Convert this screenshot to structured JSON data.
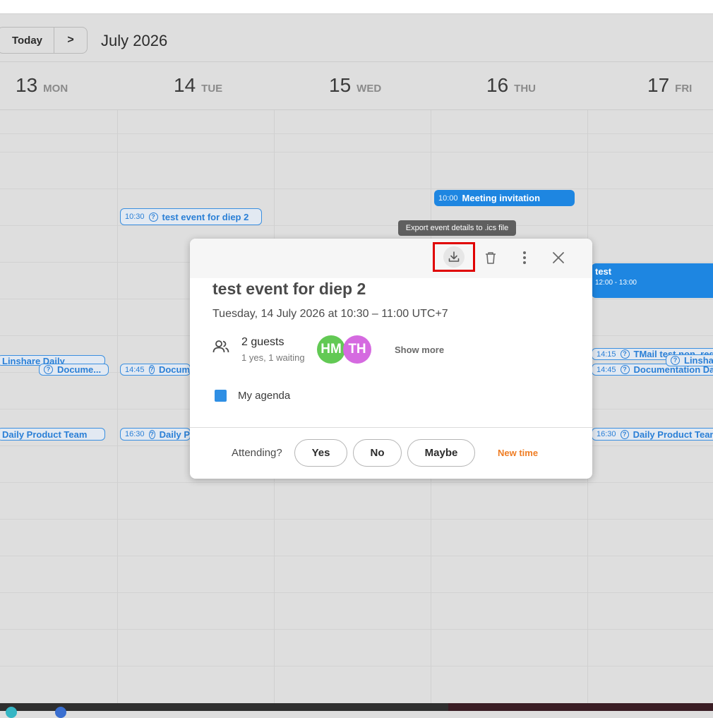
{
  "toolbar": {
    "today_label": "Today",
    "next_label": ">",
    "month_title": "July 2026"
  },
  "days": [
    {
      "num": "13",
      "name": "MON"
    },
    {
      "num": "14",
      "name": "TUE"
    },
    {
      "num": "15",
      "name": "WED"
    },
    {
      "num": "16",
      "name": "THU"
    },
    {
      "num": "17",
      "name": "FRI"
    }
  ],
  "events": {
    "tue_1030": {
      "time": "10:30",
      "title": "test event for diep 2"
    },
    "thu_1000": {
      "time": "10:00",
      "title": "Meeting invitation"
    },
    "fri_test": {
      "title": "test",
      "time": "12:00 - 13:00"
    },
    "mon_linshare": {
      "title": "Linshare Daily"
    },
    "mon_docume": {
      "title": "Docume..."
    },
    "tue_1445": {
      "time": "14:45",
      "title": "Docum"
    },
    "fri_1415": {
      "time": "14:15",
      "title": "TMail test non_reg"
    },
    "fri_linsha": {
      "title": "Linsha"
    },
    "fri_1445": {
      "time": "14:45",
      "title": "Documentation Dai"
    },
    "mon_daily": {
      "title": "Daily Product Team"
    },
    "tue_1630": {
      "time": "16:30",
      "title": "Daily P"
    },
    "fri_1630": {
      "time": "16:30",
      "title": "Daily Product Team"
    }
  },
  "tooltip": "Export event details to .ics file",
  "popup": {
    "title": "test event for diep 2",
    "when": "Tuesday, 14 July 2026 at 10:30 – 11:00 UTC+7",
    "guests_count": "2 guests",
    "guests_status": "1 yes, 1 waiting",
    "avatars": [
      {
        "initials": "HM",
        "color": "#62c954"
      },
      {
        "initials": "TH",
        "color": "#d56ae0"
      }
    ],
    "show_more": "Show more",
    "agenda_label": "My agenda",
    "agenda_color": "#2f8fe4",
    "attending_label": "Attending?",
    "yes_label": "Yes",
    "no_label": "No",
    "maybe_label": "Maybe",
    "new_time_label": "New time",
    "icons": [
      "download-icon",
      "trash-icon",
      "more-vert-icon",
      "close-icon"
    ]
  },
  "colors": {
    "accent": "#1e86e1",
    "new_time": "#ef7d24",
    "highlight_box": "#e00000"
  }
}
